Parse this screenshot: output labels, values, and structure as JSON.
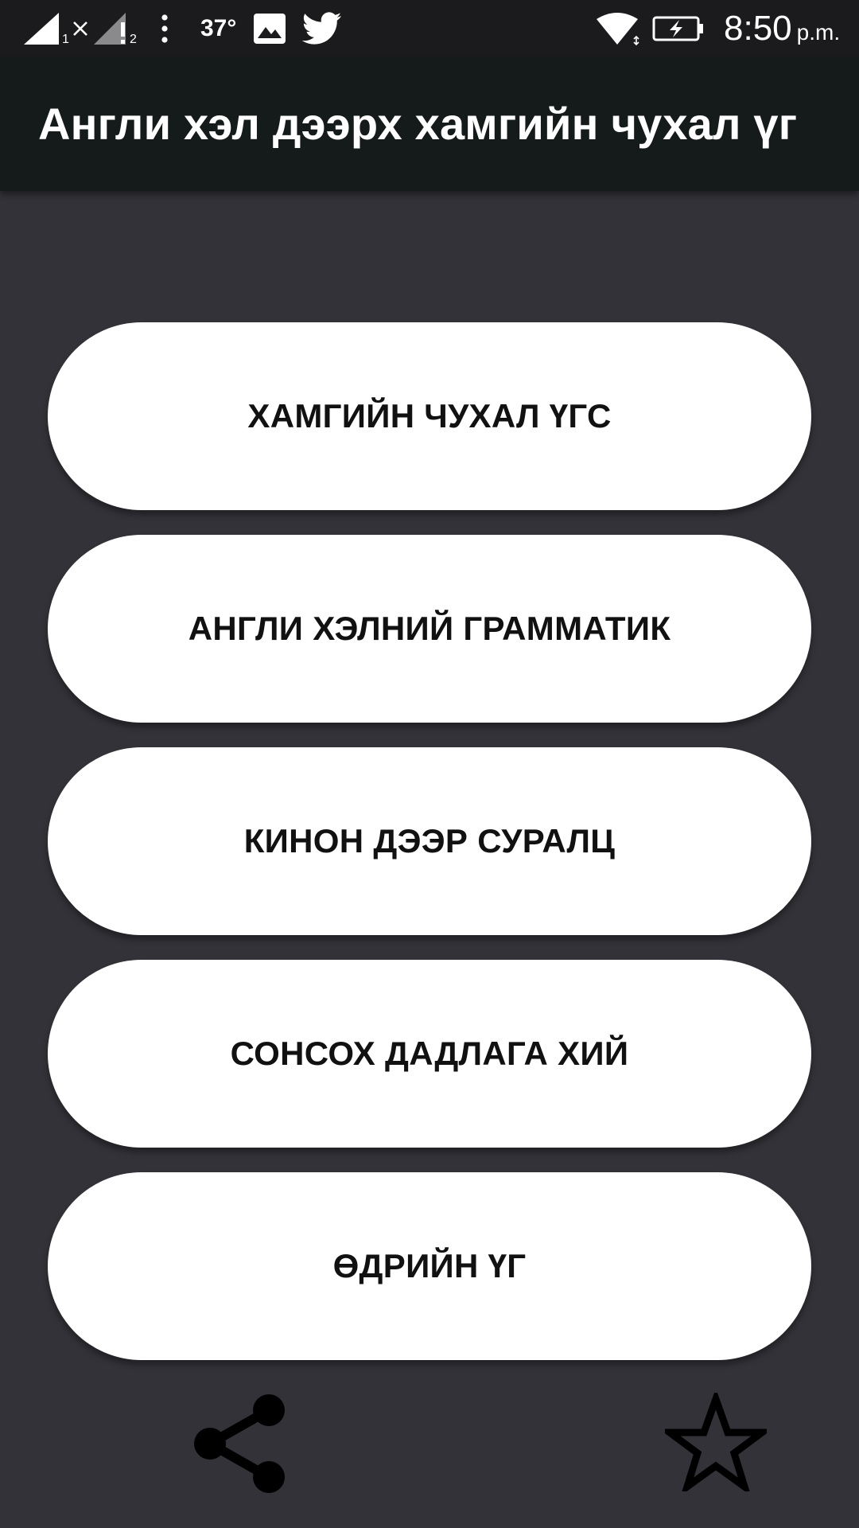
{
  "status_bar": {
    "signal_sim1": "1",
    "signal_sim2": "2",
    "temperature": "37°",
    "time": "8:50",
    "ampm": "p.m."
  },
  "app_bar": {
    "title": "Англи хэл дээрх хамгийн чухал үг"
  },
  "menu": {
    "items": [
      {
        "label": "ХАМГИЙН ЧУХАЛ ҮГС"
      },
      {
        "label": "АНГЛИ ХЭЛНИЙ ГРАММАТИК"
      },
      {
        "label": "КИНОН ДЭЭР СУРАЛЦ"
      },
      {
        "label": "СОНСОХ ДАДЛАГА ХИЙ"
      },
      {
        "label": "ӨДРИЙН ҮГ"
      }
    ]
  },
  "bottom_actions": {
    "share_icon": "share-icon",
    "favorite_icon": "star-outline-icon"
  },
  "colors": {
    "status_bar_bg": "#1b1b1d",
    "app_bar_bg": "#151b1b",
    "background": "#333238",
    "button_bg": "#ffffff",
    "button_text": "#111111",
    "icon_color": "#000000"
  }
}
